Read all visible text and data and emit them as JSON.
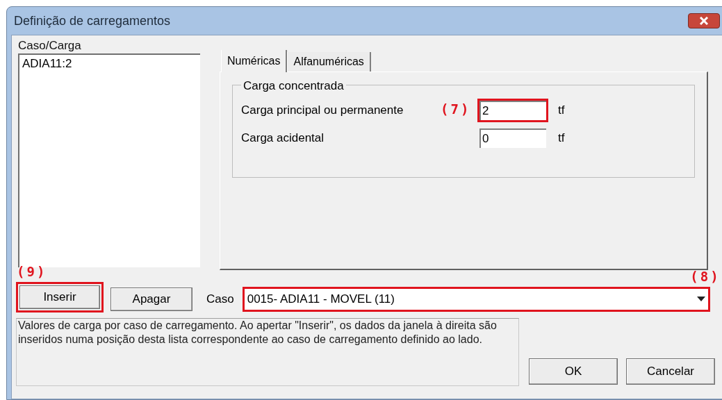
{
  "window": {
    "title": "Definição de carregamentos"
  },
  "case_list": {
    "label": "Caso/Carga",
    "items": [
      "ADIA11:2"
    ]
  },
  "tabs": [
    {
      "label": "Numéricas",
      "selected": true
    },
    {
      "label": "Alfanuméricas",
      "selected": false
    }
  ],
  "group": {
    "title": "Carga concentrada",
    "fields": [
      {
        "label": "Carga principal ou permanente",
        "value": "2",
        "unit": "tf",
        "callout": "(7)"
      },
      {
        "label": "Carga acidental",
        "value": "0",
        "unit": "tf"
      }
    ]
  },
  "buttons": [
    {
      "label": "Inserir",
      "callout": "(9)"
    },
    {
      "label": "Apagar"
    }
  ],
  "case_select": {
    "label": "Caso",
    "value": "0015- ADIA11 - MOVEL (11)",
    "callout": "(8)"
  },
  "description": "Valores de carga por caso de carregamento. Ao apertar \"Inserir\", os dados da janela à direita são inseridos numa posição desta lista correspondente ao caso de carregamento definido ao lado.",
  "dialog_buttons": [
    "OK",
    "Cancelar"
  ]
}
